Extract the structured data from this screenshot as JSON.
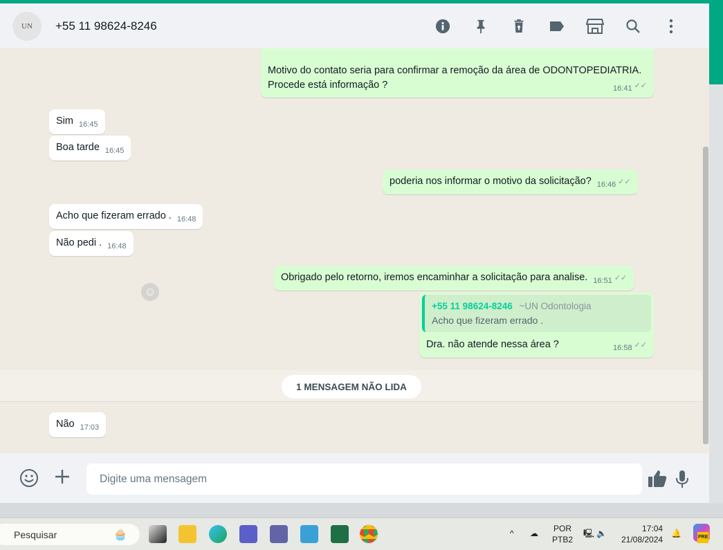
{
  "header": {
    "contact": "+55 11 98624-8246",
    "avatar_text": "UN"
  },
  "messages": [
    {
      "dir": "out",
      "text": "Motivo do contato seria para confirmar a remoção da área de ODONTOPEDIATRIA. Procede está informação ?",
      "time": "16:41"
    },
    {
      "dir": "in",
      "text": "Sim",
      "time": "16:45"
    },
    {
      "dir": "in",
      "text": "Boa tarde",
      "time": "16:45"
    },
    {
      "dir": "out",
      "text": "poderia nos informar o motivo da solicitação?",
      "time": "16:46"
    },
    {
      "dir": "in",
      "text": "Acho que fizeram errado .",
      "time": "16:48"
    },
    {
      "dir": "in",
      "text": "Não pedi .",
      "time": "16:48"
    },
    {
      "dir": "out",
      "text": "Obrigado pelo retorno, iremos encaminhar a solicitação para analise.",
      "time": "16:51"
    },
    {
      "dir": "out",
      "text": "Dra. não atende nessa área ?",
      "time": "16:58",
      "quote": {
        "author": "+55 11 98624-8246",
        "name": "~UN Odontologia",
        "text": "Acho que fizeram errado ."
      }
    },
    {
      "dir": "in",
      "text": "Não",
      "time": "17:03"
    }
  ],
  "unread_label": "1 MENSAGEM NÃO LIDA",
  "composer": {
    "placeholder": "Digite uma mensagem"
  },
  "taskbar": {
    "search": "Pesquisar",
    "lang1": "POR",
    "lang2": "PTB2",
    "time": "17:04",
    "date": "21/08/2024",
    "copilot_badge": "PRE"
  },
  "colors": {
    "accent": "#00a884",
    "outgoing": "#d9fdd3",
    "incoming": "#ffffff",
    "chat_bg": "#efeae2"
  }
}
